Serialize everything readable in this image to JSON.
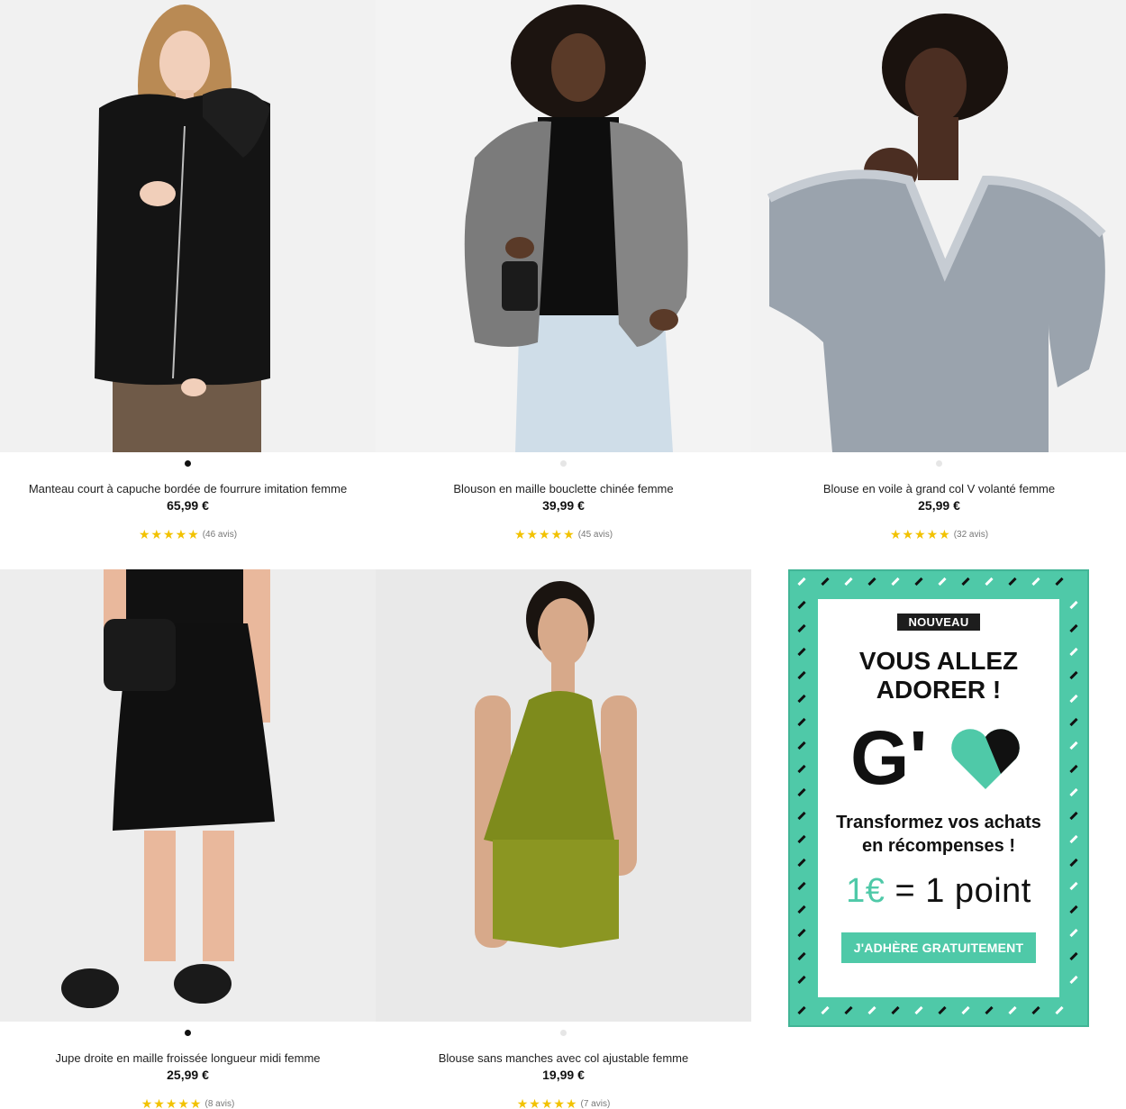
{
  "products": [
    {
      "title": "Manteau court à capuche bordée de fourrure imitation femme",
      "price": "65,99 €",
      "stars": "★★★★★",
      "reviews": "(46 avis)"
    },
    {
      "title": "Blouson en maille bouclette chinée femme",
      "price": "39,99 €",
      "stars": "★★★★★",
      "reviews": "(45 avis)"
    },
    {
      "title": "Blouse en voile à grand col V volanté femme",
      "price": "25,99 €",
      "stars": "★★★★★",
      "reviews": "(32 avis)"
    },
    {
      "title": "Jupe droite en maille froissée longueur midi femme",
      "price": "25,99 €",
      "stars": "★★★★★",
      "reviews": "(8 avis)"
    },
    {
      "title": "Blouse sans manches avec col ajustable femme",
      "price": "19,99 €",
      "stars": "★★★★★",
      "reviews": "(7 avis)"
    }
  ],
  "promo": {
    "badge": "NOUVEAU",
    "headline_line1": "VOUS ALLEZ",
    "headline_line2": "ADORER !",
    "logo_letters": "G'",
    "tagline_line1": "Transformez vos achats",
    "tagline_line2": "en récompenses !",
    "points_euro": "1€",
    "points_rest": " = 1 point",
    "cta": "J'ADHÈRE GRATUITEMENT"
  },
  "colors": {
    "accent": "#4fc9a8",
    "star": "#f2c200",
    "text": "#111111"
  },
  "icons": [
    "star-icon",
    "heart-icon",
    "carousel-dot"
  ]
}
